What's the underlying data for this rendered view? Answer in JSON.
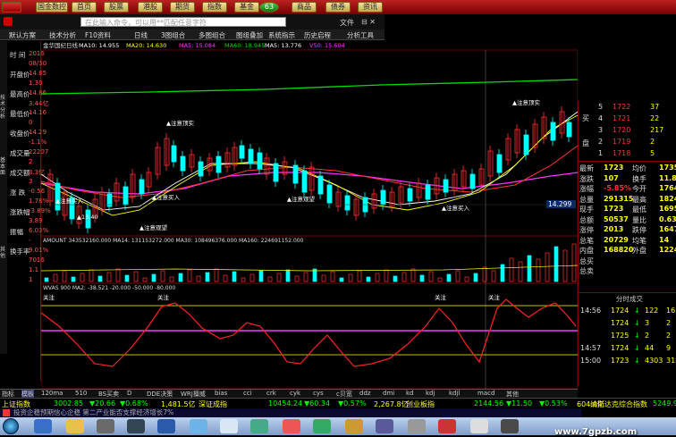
{
  "nav": {
    "items": [
      "国金数控",
      "首页",
      "股票",
      "港股",
      "期货",
      "指数",
      "基金",
      "商品",
      "债券",
      "资讯"
    ],
    "search_placeholder": "在此输入命令，可以用**匹配任意字符",
    "badge": "63",
    "file_label": "文件"
  },
  "menubar": [
    "默认方案",
    "技术分析",
    "F10资料",
    "日线",
    "3图组合",
    "多图组合",
    "图组叠加",
    "系统指示",
    "历史启程",
    "分析工具"
  ],
  "ma_line": {
    "stock": "金华国纪日线",
    "ma10": "MA10: 14.955",
    "ma20": "MA20: 14.630",
    "ma5": "MA5: 15.084",
    "ma60": "MA60: 18.945",
    "ma50": "MA5: 13.776",
    "v50": "V50: 15.604"
  },
  "left_panel": {
    "rows": [
      {
        "label": "时 间",
        "value": "2016"
      },
      {
        "label": "",
        "value": "08/30"
      },
      {
        "label": "开盘价",
        "value": "14.85"
      },
      {
        "label": "",
        "value": "1.30"
      },
      {
        "label": "最高价",
        "value": "14.86"
      },
      {
        "label": "",
        "value": "3.44亿"
      },
      {
        "label": "最低价",
        "value": "14.16"
      },
      {
        "label": "",
        "value": "0"
      },
      {
        "label": "收盘价",
        "value": "14.29"
      },
      {
        "label": "",
        "value": "-1.1%"
      },
      {
        "label": "成交量",
        "value": "22207"
      },
      {
        "label": "",
        "value": "2"
      },
      {
        "label": "成交额",
        "value": "3.3亿"
      },
      {
        "label": "",
        "value": "3"
      },
      {
        "label": "涨 跌",
        "value": "-0.56"
      },
      {
        "label": "",
        "value": "1.78%"
      },
      {
        "label": "涨跌幅",
        "value": "-3.89%"
      },
      {
        "label": "",
        "value": "3.89"
      },
      {
        "label": "振幅",
        "value": "6.03%"
      },
      {
        "label": "",
        "value": "-"
      },
      {
        "label": "换手率",
        "value": "9.01%"
      },
      {
        "label": "",
        "value": "7016"
      },
      {
        "label": "",
        "value": "1.1"
      },
      {
        "label": "",
        "value": "1"
      }
    ],
    "tabs": [
      "技术分析",
      "基本面",
      "其他"
    ]
  },
  "chart_text": {
    "amount_line": "AMOUNT 343532160.000 MA14: 131153272.000 MA30: 108496376.000 MA160: 224691152.000",
    "osc_line": "WVAS 900  MA2: -38.521  -20.000  -50.000  -80.000",
    "osc_ticks": [
      "0.02",
      "-42.32",
      "-84.65"
    ],
    "vol_tick": "7016",
    "vol_label": "X1万",
    "price_label": "14.299",
    "annot_top": [
      "注意顶实",
      "注意顶实"
    ],
    "annot_buy": [
      "注意买入",
      "注意买入",
      "注意买入",
      "注意观望",
      "注意观望",
      "注意买入"
    ],
    "low_label": "13.40",
    "focus_labels": [
      "关注",
      "关注",
      "关注",
      "关注"
    ],
    "dates": [
      "2016/06",
      "07",
      "08",
      "2016/08/30(二)"
    ]
  },
  "orderbook": {
    "sell": [
      {
        "label": "5",
        "price": "1722",
        "vol": "37"
      },
      {
        "label": "4",
        "price": "1721",
        "vol": "22"
      },
      {
        "label": "3",
        "price": "1720",
        "vol": "217"
      },
      {
        "label": "2",
        "price": "1719",
        "vol": "2"
      },
      {
        "label": "1",
        "price": "1718",
        "vol": "5"
      }
    ],
    "side_labels": [
      "买",
      "盘"
    ]
  },
  "quote": [
    {
      "l1": "最新",
      "v1": "1723",
      "l2": "均价",
      "v2": "1735"
    },
    {
      "l1": "涨跌",
      "v1": "107",
      "l2": "换手",
      "v2": "11.82%"
    },
    {
      "l1": "涨幅",
      "v1": "-5.85%",
      "l2": "今开",
      "v2": "1764"
    },
    {
      "l1": "总量",
      "v1": "291315",
      "l2": "最高",
      "v2": "1824"
    },
    {
      "l1": "现手",
      "v1": "1723",
      "l2": "最低",
      "v2": "1695"
    },
    {
      "l1": "总额",
      "v1": "50537",
      "l2": "量比",
      "v2": "0.63"
    },
    {
      "l1": "涨停",
      "v1": "2013",
      "l2": "跌停",
      "v2": "1647"
    },
    {
      "l1": "总笔",
      "v1": "20729",
      "l2": "均笔",
      "v2": "14"
    },
    {
      "l1": "内盘",
      "v1": "168820",
      "l2": "外盘",
      "v2": "122487"
    },
    {
      "l1": "总买",
      "v1": "",
      "l2": "",
      "v2": ""
    },
    {
      "l1": "总卖",
      "v1": "",
      "l2": "",
      "v2": ""
    }
  ],
  "ticks_header": "分时成交",
  "ticks": [
    {
      "t": "14:56",
      "p": "1724",
      "v": "122",
      "n": "16"
    },
    {
      "t": "",
      "p": "1724",
      "v": "3",
      "n": "2"
    },
    {
      "t": "",
      "p": "1725",
      "v": "2",
      "n": "2"
    },
    {
      "t": "14:57",
      "p": "1724",
      "v": "44",
      "n": "9"
    },
    {
      "t": "15:00",
      "p": "1723",
      "v": "4303",
      "n": "318"
    }
  ],
  "bottom_tabs": [
    "指标",
    "模板",
    "120ma",
    "510",
    "BS买卖",
    "D",
    "DDE决策",
    "WRJ擅威",
    "bias",
    "cci",
    "crk",
    "cyk",
    "cys",
    "c贝宽",
    "ddz",
    "dmi",
    "kd",
    "kdj",
    "kdjl",
    "macd",
    "其他"
  ],
  "ticker": [
    {
      "name": "上证指数",
      "value": "3002.85",
      "chg": "▼20.66",
      "pct": "▼0.68%",
      "amt": "1,481.5亿"
    },
    {
      "name": "深证成指",
      "value": "10454.24",
      "chg": "▼60.34",
      "pct": "▼0.57%",
      "amt": "2,267.8亿"
    },
    {
      "name": "创业板指",
      "value": "2144.56",
      "chg": "▼11.50",
      "pct": "▼0.53%",
      "amt": "604.0亿"
    },
    {
      "name": "纳斯达克综合指数",
      "value": "5249.90",
      "chg": "▲",
      "pct": "",
      "amt": ""
    }
  ],
  "news": "投资企稳预期信心企稳 第二产业能否支撑经济增长7%",
  "watermark": "www.7gpzb.com",
  "colors": {
    "up": "#ff3333",
    "down": "#00ffff",
    "accent": "#ffff00",
    "ma_white": "#ffffff",
    "ma_yellow": "#ffff00",
    "ma_green": "#00dd00",
    "ma_magenta": "#ff33ff",
    "ma_red": "#ff3333"
  }
}
